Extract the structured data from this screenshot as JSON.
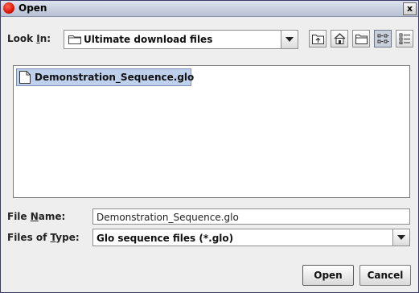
{
  "window": {
    "title": "Open",
    "close_glyph": "x"
  },
  "lookin": {
    "label_pre": "Look ",
    "label_mnemonic": "I",
    "label_post": "n:",
    "value": "Ultimate download files"
  },
  "toolbar": {
    "icons": [
      "up-one-level-icon",
      "home-icon",
      "new-folder-icon",
      "list-view-icon",
      "details-view-icon"
    ]
  },
  "files": [
    {
      "name": "Demonstration_Sequence.glo"
    }
  ],
  "filename": {
    "label_pre": "File ",
    "label_mnemonic": "N",
    "label_post": "ame:",
    "value": "Demonstration_Sequence.glo"
  },
  "filetype": {
    "label_pre": "Files of ",
    "label_mnemonic": "T",
    "label_post": "ype:",
    "value": "Glo sequence files (*.glo)"
  },
  "buttons": {
    "open": "Open",
    "cancel": "Cancel"
  }
}
